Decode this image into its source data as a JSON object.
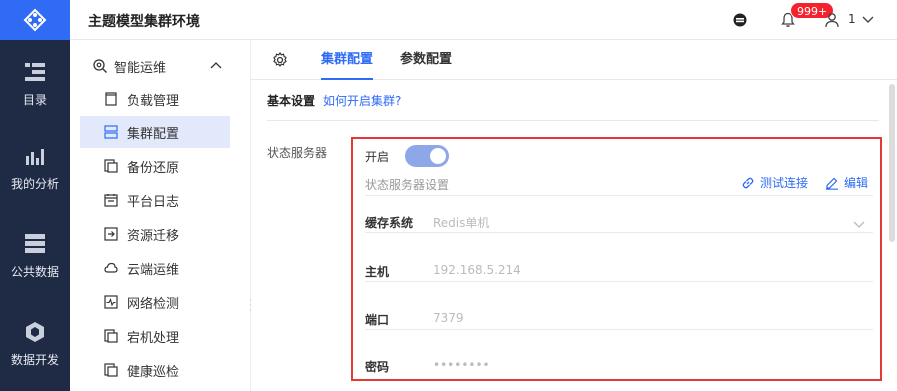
{
  "header": {
    "title": "主题模型集群环境",
    "badge": "999+",
    "user_count": "1"
  },
  "rail": {
    "items": [
      {
        "label": "目录",
        "icon": "catalog-icon"
      },
      {
        "label": "我的分析",
        "icon": "chart-icon"
      },
      {
        "label": "公共数据",
        "icon": "database-icon"
      },
      {
        "label": "数据开发",
        "icon": "cube-icon"
      }
    ]
  },
  "subnav": {
    "group": "智能运维",
    "items": [
      {
        "label": "负载管理"
      },
      {
        "label": "集群配置",
        "active": true
      },
      {
        "label": "备份还原"
      },
      {
        "label": "平台日志"
      },
      {
        "label": "资源迁移"
      },
      {
        "label": "云端运维"
      },
      {
        "label": "网络检测"
      },
      {
        "label": "宕机处理"
      },
      {
        "label": "健康巡检"
      }
    ]
  },
  "tabs": [
    {
      "label": "集群配置",
      "active": true
    },
    {
      "label": "参数配置",
      "active": false
    }
  ],
  "section": {
    "title": "基本设置",
    "help_link": "如何开启集群?"
  },
  "state_server": {
    "label": "状态服务器",
    "open_label": "开启",
    "enabled": true,
    "settings_title": "状态服务器设置",
    "test_label": "测试连接",
    "edit_label": "编辑",
    "fields": [
      {
        "label": "缓存系统",
        "value": "Redis单机"
      },
      {
        "label": "主机",
        "value": "192.168.5.214"
      },
      {
        "label": "端口",
        "value": "7379"
      },
      {
        "label": "密码",
        "value": "••••••••"
      }
    ]
  },
  "colors": {
    "accent": "#2f6bf5",
    "rail_bg": "#1f2b45",
    "highlight_border": "#e53935",
    "badge": "#f5222d"
  }
}
